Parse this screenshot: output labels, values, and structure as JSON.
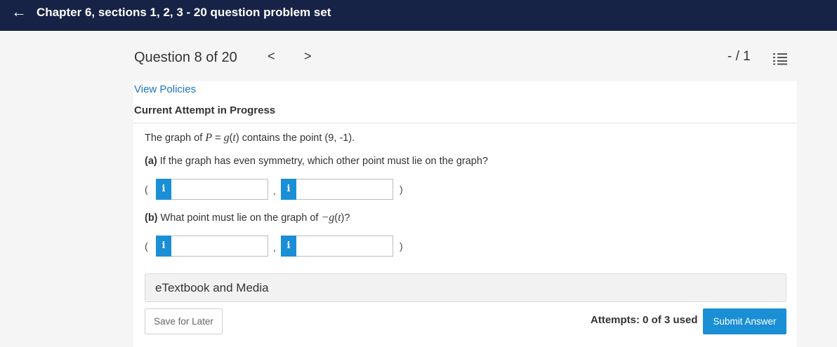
{
  "header": {
    "back_icon": "arrow-left-icon",
    "title": "Chapter 6, sections 1, 2, 3 - 20 question problem set"
  },
  "question_nav": {
    "label": "Question 8 of 20",
    "prev_glyph": "<",
    "next_glyph": ">",
    "score": "- / 1",
    "list_icon": "question-list-icon"
  },
  "policies_link": "View Policies",
  "attempt_status": "Current Attempt in Progress",
  "question": {
    "intro": {
      "before": "The graph of ",
      "var_p": "P",
      "eq": " = ",
      "func": "g",
      "paren_open": "(",
      "var_t": "t",
      "paren_close": ")",
      "after": " contains the point (9, -1)."
    },
    "part_a": {
      "tag": "(a)",
      "text": " If the graph has even symmetry, which other point must lie on the graph?"
    },
    "part_b": {
      "tag": "(b)",
      "text_before": " What point must lie on the graph of ",
      "neg_func": "−g",
      "paren_open": "(",
      "var_t": "t",
      "text_after": ")?"
    },
    "point_open": "(",
    "point_comma": ",",
    "point_close": ")",
    "info_glyph": "i",
    "inputs": {
      "a_x": "",
      "a_y": "",
      "b_x": "",
      "b_y": ""
    }
  },
  "etextbook_label": "eTextbook and Media",
  "footer": {
    "save_label": "Save for Later",
    "attempts": "Attempts: 0 of 3 used",
    "submit_label": "Submit Answer"
  },
  "colors": {
    "header_bg": "#172346",
    "accent": "#1a8fd6",
    "link": "#1a73c4"
  }
}
